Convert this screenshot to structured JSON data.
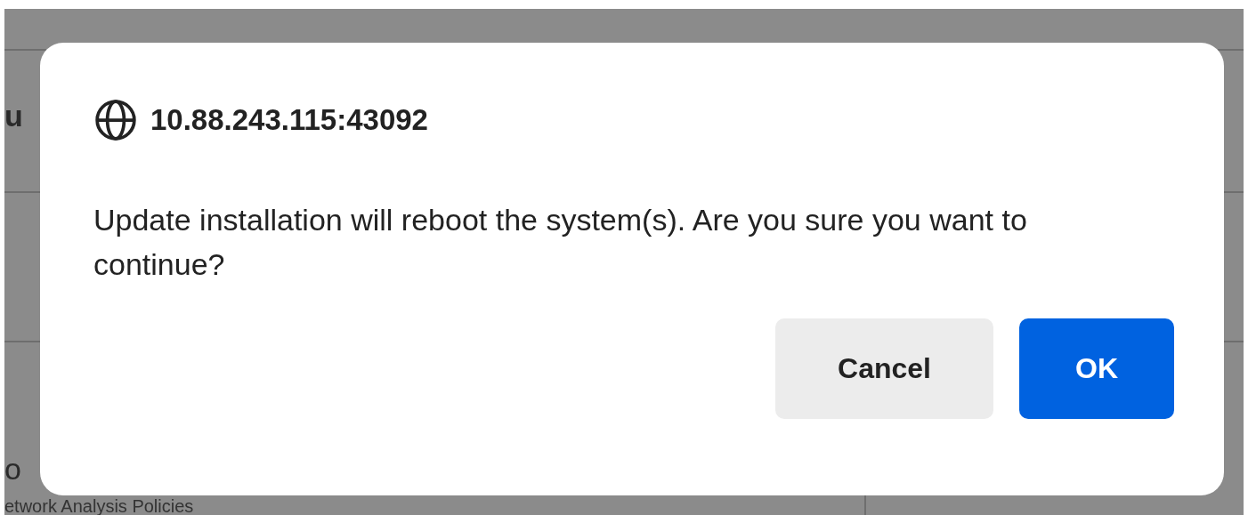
{
  "background": {
    "texts": [
      "u",
      "o",
      "etwork Analysis Policies"
    ]
  },
  "dialog": {
    "title": "10.88.243.115:43092",
    "message": "Update installation will reboot the system(s).  Are you sure you want to continue?",
    "buttons": [
      {
        "label": "Cancel",
        "kind": "secondary"
      },
      {
        "label": "OK",
        "kind": "primary"
      }
    ]
  }
}
